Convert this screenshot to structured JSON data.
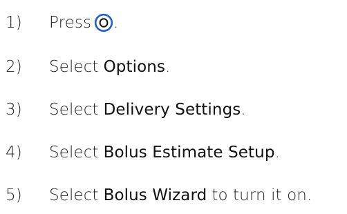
{
  "steps": [
    {
      "number": "1)",
      "verb": "Press",
      "icon": "round-o-button-icon",
      "punct": "."
    },
    {
      "number": "2)",
      "verb": "Select",
      "target": "Options",
      "punct": "."
    },
    {
      "number": "3)",
      "verb": "Select",
      "target": "Delivery Settings",
      "punct": "."
    },
    {
      "number": "4)",
      "verb": "Select",
      "target": "Bolus Estimate Setup",
      "punct": "."
    },
    {
      "number": "5)",
      "verb": "Select",
      "target": "Bolus Wizard",
      "suffix": "to turn it on."
    }
  ],
  "colors": {
    "text": "#222222",
    "icon_ring": "#1f5fd1"
  }
}
